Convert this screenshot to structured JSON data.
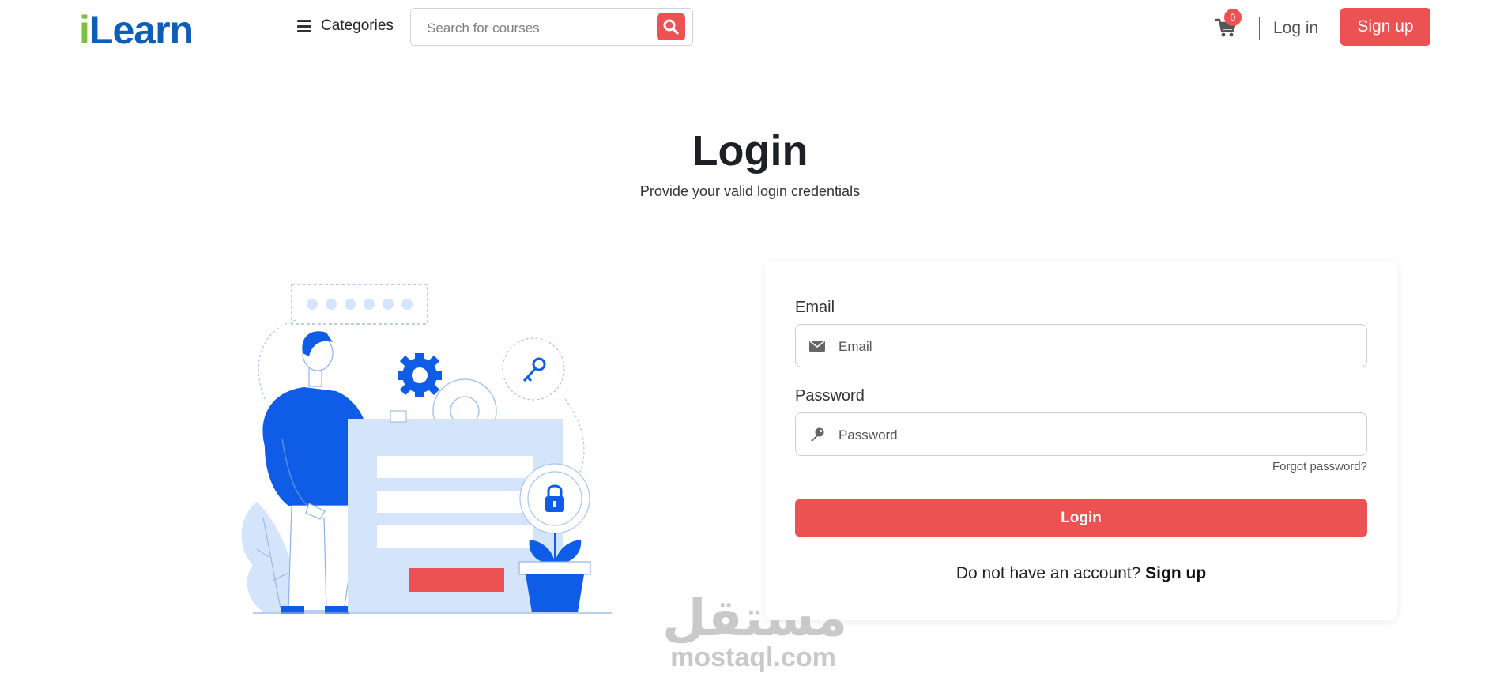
{
  "header": {
    "logo_prefix": "i",
    "logo_rest": "Learn",
    "categories_label": "Categories",
    "search": {
      "placeholder": "Search for courses",
      "value": ""
    },
    "cart_count": "0",
    "login_label": "Log in",
    "signup_label": "Sign up"
  },
  "main": {
    "title": "Login",
    "subtitle": "Provide your valid login credentials"
  },
  "form": {
    "email_label": "Email",
    "email_placeholder": "Email",
    "password_label": "Password",
    "password_placeholder": "Password",
    "forgot_label": "Forgot password?",
    "login_button": "Login",
    "no_account_text": "Do not have an account?",
    "signup_link": "Sign up"
  },
  "watermark": {
    "arabic": "مستقل",
    "latin": "mostaql.com"
  },
  "colors": {
    "accent": "#ec5252",
    "brand_blue": "#0e5db7",
    "brand_green": "#7cbf45",
    "illustration_blue": "#0f5ce6",
    "illustration_light": "#d4e4fb"
  },
  "icons": [
    "hamburger-icon",
    "search-icon",
    "cart-icon",
    "envelope-icon",
    "key-icon"
  ]
}
